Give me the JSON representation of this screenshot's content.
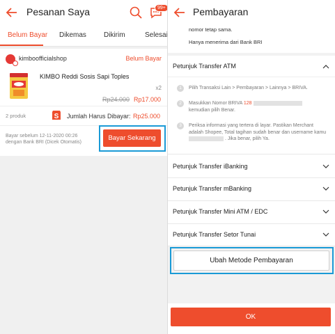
{
  "left": {
    "header": {
      "title": "Pesanan Saya",
      "badge": "99+"
    },
    "tabs": [
      {
        "label": "Belum Bayar"
      },
      {
        "label": "Dikemas"
      },
      {
        "label": "Dikirim"
      },
      {
        "label": "Selesai"
      }
    ],
    "order": {
      "shop_name": "kimboofficialshop",
      "status": "Belum Bayar",
      "product_name": "KIMBO Reddi Sosis Sapi Toples",
      "quantity": "x2",
      "old_price": "Rp24.000",
      "new_price": "Rp17.000",
      "product_count": "2 produk",
      "total_label": "Jumlah Harus Dibayar:",
      "total_value": "Rp25.000",
      "pay_note_1": "Bayar sebelum 12-11-2020 00:26",
      "pay_note_2": "dengan Bank BRI (Dicek Otomatis)",
      "pay_button": "Bayar Sekarang"
    }
  },
  "right": {
    "header": {
      "title": "Pembayaran"
    },
    "top_note_1": "nomor tetap sama.",
    "top_note_2": "Hanya menerima dari Bank BRI",
    "atm": {
      "title": "Petunjuk Transfer ATM",
      "steps": [
        {
          "n": "1",
          "text": "Pilih Transaksi Lain > Pembayaran > Lainnya > BRIVA."
        },
        {
          "n": "2",
          "text_a": "Masukkan Nomor BRIVA",
          "text_num": "128",
          "text_b": "kemudian pilih Benar."
        },
        {
          "n": "3",
          "text_a": "Periksa informasi yang tertera di layar. Pastikan Merchant adalah Shopee, Total tagihan sudah benar dan username kamu",
          "text_b": ". Jika benar, pilih Ya."
        }
      ]
    },
    "sections": [
      {
        "title": "Petunjuk Transfer iBanking"
      },
      {
        "title": "Petunjuk Transfer mBanking"
      },
      {
        "title": "Petunjuk Transfer Mini ATM / EDC"
      },
      {
        "title": "Petunjuk Transfer Setor Tunai"
      }
    ],
    "change_method_button": "Ubah Metode Pembayaran",
    "ok_button": "OK"
  },
  "colors": {
    "accent": "#ee4d2d",
    "highlight": "#1a9ad6"
  }
}
